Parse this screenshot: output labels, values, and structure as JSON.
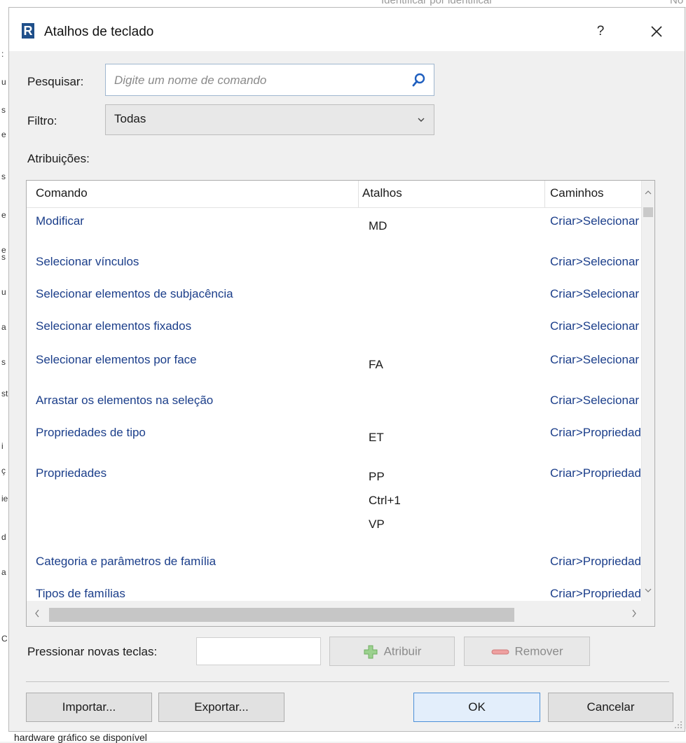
{
  "background": {
    "top_text": "Identificar por identificar",
    "top_right_text": "No",
    "bottom_text": "hardware gráfico se disponível",
    "left_fragments": [
      ":",
      "u",
      "s",
      "e",
      "s",
      "e",
      "e",
      "s",
      "u",
      "a",
      "s",
      "st",
      "i",
      "ç",
      "ie",
      "d",
      "a",
      "C"
    ]
  },
  "dialog": {
    "title": "Atalhos de teclado",
    "app_icon": "R",
    "help_label": "?",
    "close_label": "✕"
  },
  "search": {
    "label": "Pesquisar:",
    "placeholder": "Digite um nome de comando",
    "value": ""
  },
  "filter": {
    "label": "Filtro:",
    "selected": "Todas"
  },
  "assignments": {
    "label": "Atribuições:",
    "columns": [
      "Comando",
      "Atalhos",
      "Caminhos"
    ],
    "rows": [
      {
        "command": "Modificar",
        "shortcuts": [
          "MD"
        ],
        "path": "Criar>Selecionar"
      },
      {
        "command": "Selecionar vínculos",
        "shortcuts": [],
        "path": "Criar>Selecionar"
      },
      {
        "command": "Selecionar elementos de subjacência",
        "shortcuts": [],
        "path": "Criar>Selecionar"
      },
      {
        "command": "Selecionar elementos fixados",
        "shortcuts": [],
        "path": "Criar>Selecionar"
      },
      {
        "command": "Selecionar elementos por face",
        "shortcuts": [
          "FA"
        ],
        "path": "Criar>Selecionar"
      },
      {
        "command": "Arrastar os elementos na seleção",
        "shortcuts": [],
        "path": "Criar>Selecionar"
      },
      {
        "command": "Propriedades de tipo",
        "shortcuts": [
          "ET"
        ],
        "path": "Criar>Propriedades"
      },
      {
        "command": "Propriedades",
        "shortcuts": [
          "PP",
          "Ctrl+1",
          "VP"
        ],
        "path": "Criar>Propriedades"
      },
      {
        "command": "Categoria e parâmetros de família",
        "shortcuts": [],
        "path": "Criar>Propriedades"
      },
      {
        "command": "Tipos de famílias",
        "shortcuts": [],
        "path": "Criar>Propriedades"
      }
    ]
  },
  "keys": {
    "label": "Pressionar novas teclas:",
    "value": "",
    "assign_label": "Atribuir",
    "remove_label": "Remover"
  },
  "footer": {
    "import_label": "Importar...",
    "export_label": "Exportar...",
    "ok_label": "OK",
    "cancel_label": "Cancelar"
  },
  "colors": {
    "link_blue": "#1b3e8a",
    "accent": "#4d90d8",
    "dialog_bg": "#f0f0f0",
    "assign_green": "#7bc86c",
    "remove_red": "#e08585"
  }
}
